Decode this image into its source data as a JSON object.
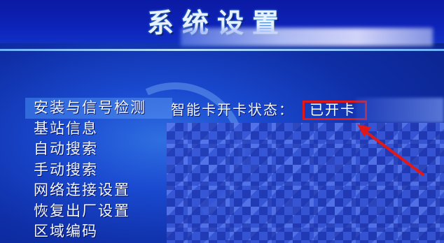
{
  "header": {
    "title": "系统设置"
  },
  "menu": {
    "items": [
      {
        "label": "安装与信号检测",
        "selected": true
      },
      {
        "label": "基站信息",
        "selected": false
      },
      {
        "label": "自动搜索",
        "selected": false
      },
      {
        "label": "手动搜索",
        "selected": false
      },
      {
        "label": "网络连接设置",
        "selected": false
      },
      {
        "label": "恢复出厂设置",
        "selected": false
      },
      {
        "label": "区域编码",
        "selected": false
      }
    ]
  },
  "panel": {
    "smartcard_label": "智能卡开卡状态：",
    "smartcard_value": "已开卡"
  },
  "colors": {
    "background": "#0a1f8a",
    "highlight_box": "#e01818",
    "annotation_arrow": "#e01818"
  }
}
